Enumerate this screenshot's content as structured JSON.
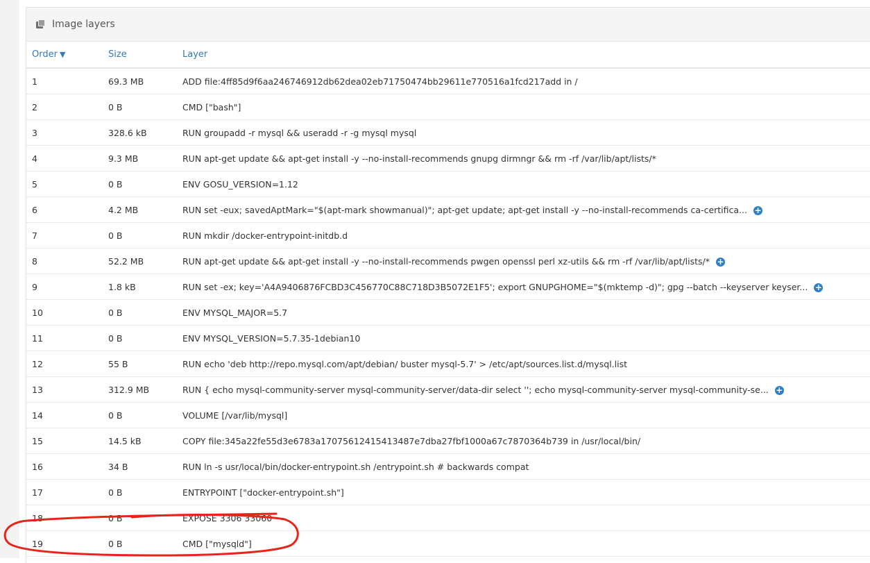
{
  "panel": {
    "title": "Image layers",
    "title_icon": "layers-icon"
  },
  "table": {
    "headers": {
      "order": "Order",
      "size": "Size",
      "layer": "Layer"
    },
    "sort_icon": "chevron-down-icon",
    "rows": [
      {
        "order": "1",
        "size": "69.3 MB",
        "layer": "ADD file:4ff85d9f6aa246746912db62dea02eb71750474bb29611e770516a1fcd217add in /",
        "expandable": false
      },
      {
        "order": "2",
        "size": "0 B",
        "layer": "CMD [\"bash\"]",
        "expandable": false
      },
      {
        "order": "3",
        "size": "328.6 kB",
        "layer": "RUN groupadd -r mysql && useradd -r -g mysql mysql",
        "expandable": false
      },
      {
        "order": "4",
        "size": "9.3 MB",
        "layer": "RUN apt-get update && apt-get install -y --no-install-recommends gnupg dirmngr && rm -rf /var/lib/apt/lists/*",
        "expandable": false
      },
      {
        "order": "5",
        "size": "0 B",
        "layer": "ENV GOSU_VERSION=1.12",
        "expandable": false
      },
      {
        "order": "6",
        "size": "4.2 MB",
        "layer": "RUN set -eux; savedAptMark=\"$(apt-mark showmanual)\"; apt-get update; apt-get install -y --no-install-recommends ca-certifica...",
        "expandable": true
      },
      {
        "order": "7",
        "size": "0 B",
        "layer": "RUN mkdir /docker-entrypoint-initdb.d",
        "expandable": false
      },
      {
        "order": "8",
        "size": "52.2 MB",
        "layer": "RUN apt-get update && apt-get install -y --no-install-recommends pwgen openssl perl xz-utils && rm -rf /var/lib/apt/lists/*",
        "expandable": true
      },
      {
        "order": "9",
        "size": "1.8 kB",
        "layer": "RUN set -ex; key='A4A9406876FCBD3C456770C88C718D3B5072E1F5'; export GNUPGHOME=\"$(mktemp -d)\"; gpg --batch --keyserver keyser...",
        "expandable": true
      },
      {
        "order": "10",
        "size": "0 B",
        "layer": "ENV MYSQL_MAJOR=5.7",
        "expandable": false
      },
      {
        "order": "11",
        "size": "0 B",
        "layer": "ENV MYSQL_VERSION=5.7.35-1debian10",
        "expandable": false
      },
      {
        "order": "12",
        "size": "55 B",
        "layer": "RUN echo 'deb http://repo.mysql.com/apt/debian/ buster mysql-5.7' > /etc/apt/sources.list.d/mysql.list",
        "expandable": false
      },
      {
        "order": "13",
        "size": "312.9 MB",
        "layer": "RUN { echo mysql-community-server mysql-community-server/data-dir select ''; echo mysql-community-server mysql-community-se...",
        "expandable": true
      },
      {
        "order": "14",
        "size": "0 B",
        "layer": "VOLUME [/var/lib/mysql]",
        "expandable": false
      },
      {
        "order": "15",
        "size": "14.5 kB",
        "layer": "COPY file:345a22fe55d3e6783a17075612415413487e7dba27fbf1000a67c7870364b739 in /usr/local/bin/",
        "expandable": false
      },
      {
        "order": "16",
        "size": "34 B",
        "layer": "RUN ln -s usr/local/bin/docker-entrypoint.sh /entrypoint.sh # backwards compat",
        "expandable": false
      },
      {
        "order": "17",
        "size": "0 B",
        "layer": "ENTRYPOINT [\"docker-entrypoint.sh\"]",
        "expandable": false
      },
      {
        "order": "18",
        "size": "0 B",
        "layer": "EXPOSE 3306 33060",
        "expandable": false
      },
      {
        "order": "19",
        "size": "0 B",
        "layer": "CMD [\"mysqld\"]",
        "expandable": false
      }
    ],
    "expand_icon": "plus-circle-icon"
  },
  "colors": {
    "accent": "#337ab7",
    "expand_icon": "#2f7fc6",
    "annotation": "#e8231a"
  }
}
